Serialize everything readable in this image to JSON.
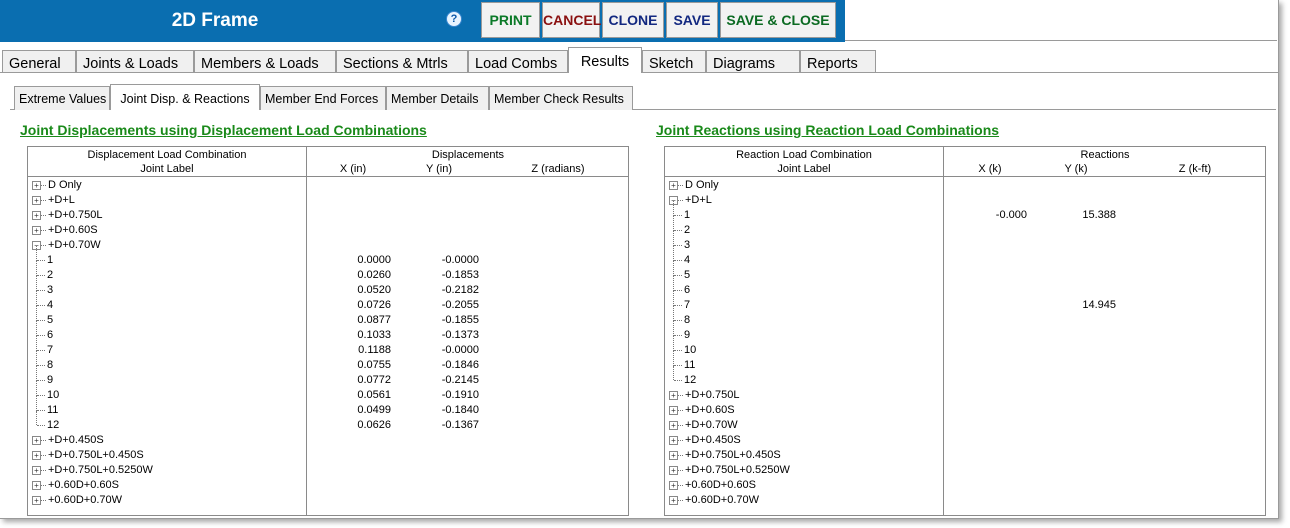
{
  "window": {
    "title": "2D Frame",
    "help_glyph": "?"
  },
  "toolbar": {
    "print": "PRINT",
    "cancel": "CANCEL",
    "clone": "CLONE",
    "save": "SAVE",
    "save_close": "SAVE & CLOSE"
  },
  "main_tabs": [
    "General",
    "Joints & Loads",
    "Members & Loads",
    "Sections & Mtrls",
    "Load Combs",
    "Results",
    "Sketch",
    "Diagrams",
    "Reports"
  ],
  "active_main_tab": "Results",
  "sub_tabs": [
    "Extreme Values",
    "Joint Disp. & Reactions",
    "Member End Forces",
    "Member Details",
    "Member Check Results"
  ],
  "active_sub_tab": "Joint Disp. & Reactions",
  "displacements": {
    "title": "Joint Displacements using Displacement Load Combinations",
    "header_left_top": "Displacement Load Combination",
    "header_left_bottom": "Joint Label",
    "header_right_top": "Displacements",
    "col_x": "X  (in)",
    "col_y": "Y  (in)",
    "col_z": "Z  (radians)",
    "rows": [
      {
        "label": "D Only",
        "type": "group",
        "expanded": false
      },
      {
        "label": "+D+L",
        "type": "group",
        "expanded": false
      },
      {
        "label": "+D+0.750L",
        "type": "group",
        "expanded": false
      },
      {
        "label": "+D+0.60S",
        "type": "group",
        "expanded": false
      },
      {
        "label": "+D+0.70W",
        "type": "group",
        "expanded": true
      },
      {
        "label": "1",
        "type": "joint",
        "x": "0.0000",
        "y": "-0.0000"
      },
      {
        "label": "2",
        "type": "joint",
        "x": "0.0260",
        "y": "-0.1853"
      },
      {
        "label": "3",
        "type": "joint",
        "x": "0.0520",
        "y": "-0.2182"
      },
      {
        "label": "4",
        "type": "joint",
        "x": "0.0726",
        "y": "-0.2055"
      },
      {
        "label": "5",
        "type": "joint",
        "x": "0.0877",
        "y": "-0.1855"
      },
      {
        "label": "6",
        "type": "joint",
        "x": "0.1033",
        "y": "-0.1373"
      },
      {
        "label": "7",
        "type": "joint",
        "x": "0.1188",
        "y": "-0.0000"
      },
      {
        "label": "8",
        "type": "joint",
        "x": "0.0755",
        "y": "-0.1846"
      },
      {
        "label": "9",
        "type": "joint",
        "x": "0.0772",
        "y": "-0.2145"
      },
      {
        "label": "10",
        "type": "joint",
        "x": "0.0561",
        "y": "-0.1910"
      },
      {
        "label": "11",
        "type": "joint",
        "x": "0.0499",
        "y": "-0.1840"
      },
      {
        "label": "12",
        "type": "joint",
        "x": "0.0626",
        "y": "-0.1367"
      },
      {
        "label": "+D+0.450S",
        "type": "group",
        "expanded": false
      },
      {
        "label": "+D+0.750L+0.450S",
        "type": "group",
        "expanded": false
      },
      {
        "label": "+D+0.750L+0.5250W",
        "type": "group",
        "expanded": false
      },
      {
        "label": "+0.60D+0.60S",
        "type": "group",
        "expanded": false
      },
      {
        "label": "+0.60D+0.70W",
        "type": "group",
        "expanded": false
      }
    ]
  },
  "reactions": {
    "title": "Joint Reactions using Reaction Load Combinations",
    "header_left_top": "Reaction Load Combination",
    "header_left_bottom": "Joint Label",
    "header_right_top": "Reactions",
    "col_x": "X  (k)",
    "col_y": "Y  (k)",
    "col_z": "Z  (k-ft)",
    "rows": [
      {
        "label": "D Only",
        "type": "group",
        "expanded": false
      },
      {
        "label": "+D+L",
        "type": "group",
        "expanded": true
      },
      {
        "label": "1",
        "type": "joint",
        "x": "-0.000",
        "y": "15.388"
      },
      {
        "label": "2",
        "type": "joint",
        "x": "",
        "y": ""
      },
      {
        "label": "3",
        "type": "joint",
        "x": "",
        "y": ""
      },
      {
        "label": "4",
        "type": "joint",
        "x": "",
        "y": ""
      },
      {
        "label": "5",
        "type": "joint",
        "x": "",
        "y": ""
      },
      {
        "label": "6",
        "type": "joint",
        "x": "",
        "y": ""
      },
      {
        "label": "7",
        "type": "joint",
        "x": "",
        "y": "14.945"
      },
      {
        "label": "8",
        "type": "joint",
        "x": "",
        "y": ""
      },
      {
        "label": "9",
        "type": "joint",
        "x": "",
        "y": ""
      },
      {
        "label": "10",
        "type": "joint",
        "x": "",
        "y": ""
      },
      {
        "label": "11",
        "type": "joint",
        "x": "",
        "y": ""
      },
      {
        "label": "12",
        "type": "joint",
        "x": "",
        "y": ""
      },
      {
        "label": "+D+0.750L",
        "type": "group",
        "expanded": false
      },
      {
        "label": "+D+0.60S",
        "type": "group",
        "expanded": false
      },
      {
        "label": "+D+0.70W",
        "type": "group",
        "expanded": false
      },
      {
        "label": "+D+0.450S",
        "type": "group",
        "expanded": false
      },
      {
        "label": "+D+0.750L+0.450S",
        "type": "group",
        "expanded": false
      },
      {
        "label": "+D+0.750L+0.5250W",
        "type": "group",
        "expanded": false
      },
      {
        "label": "+0.60D+0.60S",
        "type": "group",
        "expanded": false
      },
      {
        "label": "+0.60D+0.70W",
        "type": "group",
        "expanded": false
      }
    ]
  },
  "colors": {
    "titlebar": "#0a6eb0",
    "section_title": "#1a8a1a"
  }
}
